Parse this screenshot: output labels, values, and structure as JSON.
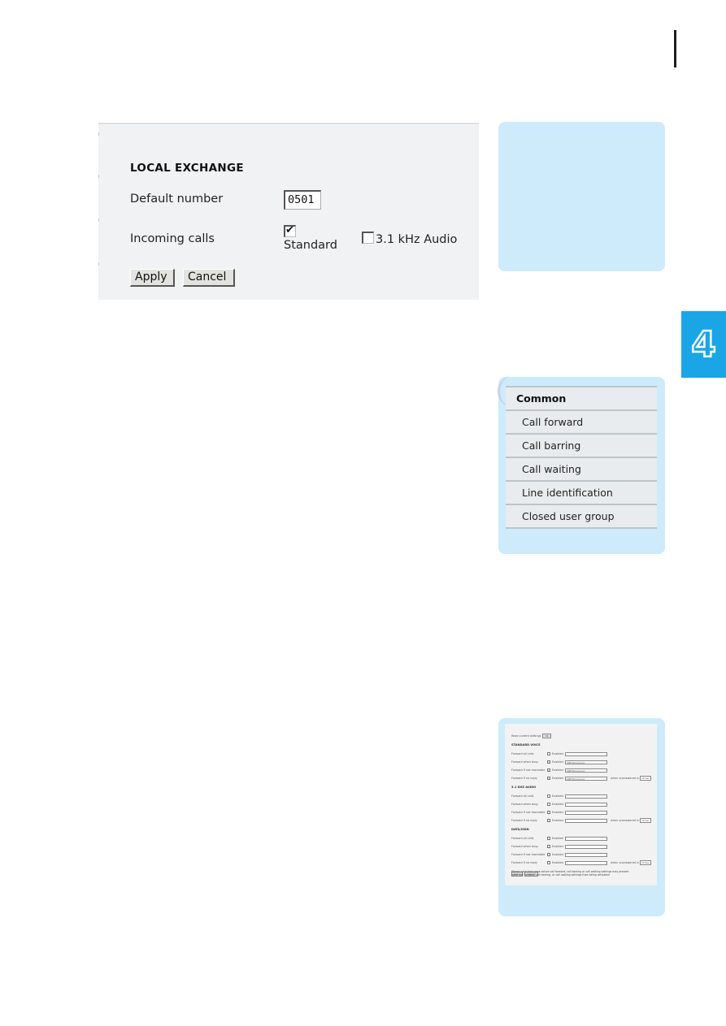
{
  "chapter": {
    "number": "4",
    "tab_color": "#1aa5e6"
  },
  "colors": {
    "note_box": "#cdebfb",
    "panel_bg": "#f1f2f3",
    "menu_bg": "#e8ecee"
  },
  "local_exchange": {
    "title": "LOCAL EXCHANGE",
    "default_number_label": "Default number",
    "default_number_value": "0501",
    "incoming_calls_label": "Incoming calls",
    "options": [
      {
        "label": "Standard",
        "checked": true
      },
      {
        "label": "3.1 kHz Audio",
        "checked": false
      }
    ],
    "apply_label": "Apply",
    "cancel_label": "Cancel"
  },
  "menu": {
    "header": "Common",
    "items": [
      {
        "label": "Call forward"
      },
      {
        "label": "Call barring"
      },
      {
        "label": "Call waiting"
      },
      {
        "label": "Line identification"
      },
      {
        "label": "Closed user group"
      }
    ]
  },
  "call_forward_thumbnail": {
    "read_label": "Read current settings",
    "read_button": "OK",
    "enabled_label": "Enabled",
    "unanswered_label": "when unanswered in",
    "unanswered_value": "20 Sec",
    "sections": [
      {
        "title": "STANDARD VOICE",
        "rows": [
          {
            "label": "Forward all calls",
            "checked": false,
            "number": ""
          },
          {
            "label": "Forward when busy",
            "checked": true,
            "number": "00870xxxxxxxx"
          },
          {
            "label": "Forward if not reachable",
            "checked": true,
            "number": "00870xxxxxxxx"
          },
          {
            "label": "Forward if no reply",
            "checked": true,
            "number": "00870xxxxxxxx",
            "has_timer": true
          }
        ]
      },
      {
        "title": "3.1 KHZ AUDIO",
        "rows": [
          {
            "label": "Forward all calls",
            "checked": false,
            "number": ""
          },
          {
            "label": "Forward when busy",
            "checked": false,
            "number": ""
          },
          {
            "label": "Forward if not reachable",
            "checked": false,
            "number": ""
          },
          {
            "label": "Forward if no reply",
            "checked": false,
            "number": "",
            "has_timer": true
          }
        ]
      },
      {
        "title": "DATA/ISDN",
        "rows": [
          {
            "label": "Forward all calls",
            "checked": false,
            "number": ""
          },
          {
            "label": "Forward when busy",
            "checked": false,
            "number": ""
          },
          {
            "label": "Forward if not reachable",
            "checked": false,
            "number": ""
          },
          {
            "label": "Forward if no reply",
            "checked": false,
            "number": "",
            "has_timer": true
          }
        ]
      }
    ],
    "apply_label": "Apply",
    "cancel_label": "Cancel",
    "note": "Please note that some active call forward, call barring or call waiting settings may prevent other call forward, call barring, or call waiting settings from being activated"
  }
}
